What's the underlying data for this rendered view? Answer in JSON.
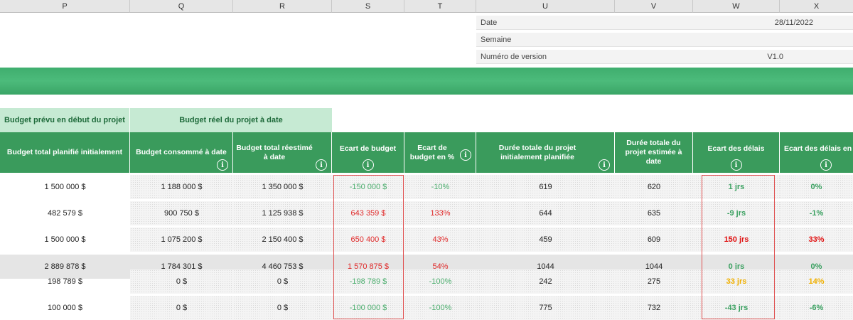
{
  "columns": [
    "P",
    "Q",
    "R",
    "S",
    "T",
    "U",
    "V",
    "W",
    "X"
  ],
  "info": {
    "date_label": "Date",
    "date_value": "28/11/2022",
    "week_label": "Semaine",
    "week_value": "",
    "version_label": "Numéro de version",
    "version_value": "V1.0"
  },
  "groups": {
    "planned": "Budget prévu en début du projet",
    "actual": "Budget réel du projet à date"
  },
  "headers": {
    "planned_total": "Budget total planifié initialement",
    "consumed": "Budget consommé à date",
    "reestimated": "Budget total réestimé à date",
    "budget_gap": "Ecart de budget",
    "budget_gap_pct": "Ecart de budget en %",
    "duration_planned": "Durée totale du projet initialement planifiée",
    "duration_estimated": "Durée totale du projet estimée à date",
    "delay_gap": "Ecart des délais",
    "delay_gap_pct": "Ecart des délais en"
  },
  "icon": "info-icon",
  "rows": [
    {
      "planned": "1 500 000 $",
      "consumed": "1 188 000 $",
      "reestimated": "1 350 000 $",
      "gap": "-150 000 $",
      "gap_pct": "-10%",
      "dur_plan": "619",
      "dur_est": "620",
      "delay": "1 jrs",
      "delay_pct": "0%"
    },
    {
      "planned": "482 579 $",
      "consumed": "900 750 $",
      "reestimated": "1 125 938 $",
      "gap": "643 359 $",
      "gap_pct": "133%",
      "dur_plan": "644",
      "dur_est": "635",
      "delay": "-9 jrs",
      "delay_pct": "-1%"
    },
    {
      "planned": "1 500 000 $",
      "consumed": "1 075 200 $",
      "reestimated": "2 150 400 $",
      "gap": "650 400 $",
      "gap_pct": "43%",
      "dur_plan": "459",
      "dur_est": "609",
      "delay": "150 jrs",
      "delay_pct": "33%"
    },
    {
      "planned": "2 889 878 $",
      "consumed": "1 784 301 $",
      "reestimated": "4 460 753 $",
      "gap": "1 570 875 $",
      "gap_pct": "54%",
      "dur_plan": "1044",
      "dur_est": "1044",
      "delay": "0 jrs",
      "delay_pct": "0%"
    },
    {
      "planned": "198 789 $",
      "consumed": "0 $",
      "reestimated": "0 $",
      "gap": "-198 789 $",
      "gap_pct": "-100%",
      "dur_plan": "242",
      "dur_est": "275",
      "delay": "33 jrs",
      "delay_pct": "14%"
    },
    {
      "planned": "100 000 $",
      "consumed": "0 $",
      "reestimated": "0 $",
      "gap": "-100 000 $",
      "gap_pct": "-100%",
      "dur_plan": "775",
      "dur_est": "732",
      "delay": "-43 jrs",
      "delay_pct": "-6%"
    }
  ],
  "colors": {
    "header_green": "#3a9b5c",
    "subheader_green": "#c6ead3",
    "banner_green": "#4cbb7b",
    "positive": "#4cae6e",
    "negative": "#e02a2a",
    "warning": "#f0b000"
  }
}
